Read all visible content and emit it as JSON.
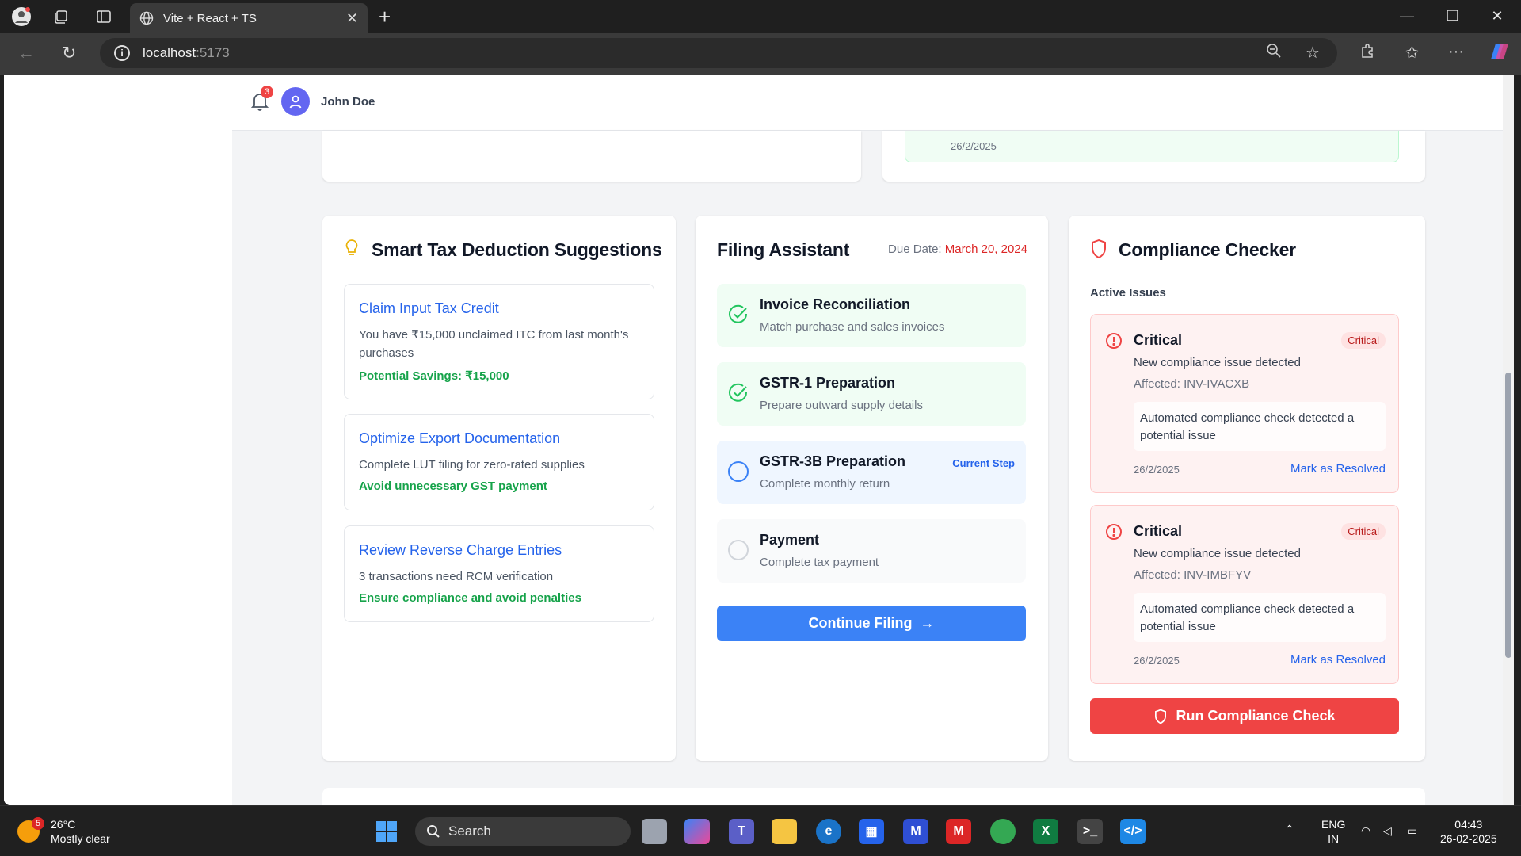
{
  "browser": {
    "tab_title": "Vite + React + TS",
    "url_host": "localhost",
    "url_port": ":5173"
  },
  "header": {
    "notification_count": "3",
    "user_name": "John Doe"
  },
  "top_card": {
    "date": "26/2/2025"
  },
  "tax_suggestions": {
    "title": "Smart Tax Deduction Suggestions",
    "items": [
      {
        "title": "Claim Input Tax Credit",
        "desc": "You have ₹15,000 unclaimed ITC from last month's purchases",
        "note": "Potential Savings: ₹15,000"
      },
      {
        "title": "Optimize Export Documentation",
        "desc": "Complete LUT filing for zero-rated supplies",
        "note": "Avoid unnecessary GST payment"
      },
      {
        "title": "Review Reverse Charge Entries",
        "desc": "3 transactions need RCM verification",
        "note": "Ensure compliance and avoid penalties"
      }
    ]
  },
  "filing": {
    "title": "Filing Assistant",
    "due_label": "Due Date:",
    "due_date": "March 20, 2024",
    "steps": [
      {
        "title": "Invoice Reconciliation",
        "desc": "Match purchase and sales invoices",
        "status": "done"
      },
      {
        "title": "GSTR-1 Preparation",
        "desc": "Prepare outward supply details",
        "status": "done"
      },
      {
        "title": "GSTR-3B Preparation",
        "desc": "Complete monthly return",
        "status": "current",
        "tag": "Current Step"
      },
      {
        "title": "Payment",
        "desc": "Complete tax payment",
        "status": "pending"
      }
    ],
    "button": "Continue Filing"
  },
  "compliance": {
    "title": "Compliance Checker",
    "active_label": "Active Issues",
    "issues": [
      {
        "title": "Critical",
        "badge": "Critical",
        "desc": "New compliance issue detected",
        "affected": "Affected: INV-IVACXB",
        "detail": "Automated compliance check detected a potential issue",
        "date": "26/2/2025",
        "action": "Mark as Resolved"
      },
      {
        "title": "Critical",
        "badge": "Critical",
        "desc": "New compliance issue detected",
        "affected": "Affected: INV-IMBFYV",
        "detail": "Automated compliance check detected a potential issue",
        "date": "26/2/2025",
        "action": "Mark as Resolved"
      }
    ],
    "button": "Run Compliance Check"
  },
  "taskbar": {
    "weather_badge": "5",
    "temp": "26°C",
    "condition": "Mostly clear",
    "search": "Search",
    "lang1": "ENG",
    "lang2": "IN",
    "time": "04:43",
    "date": "26-02-2025"
  },
  "colors": {
    "primary": "#3b82f6",
    "danger": "#ef4444",
    "success": "#16a34a",
    "link": "#2563eb"
  }
}
